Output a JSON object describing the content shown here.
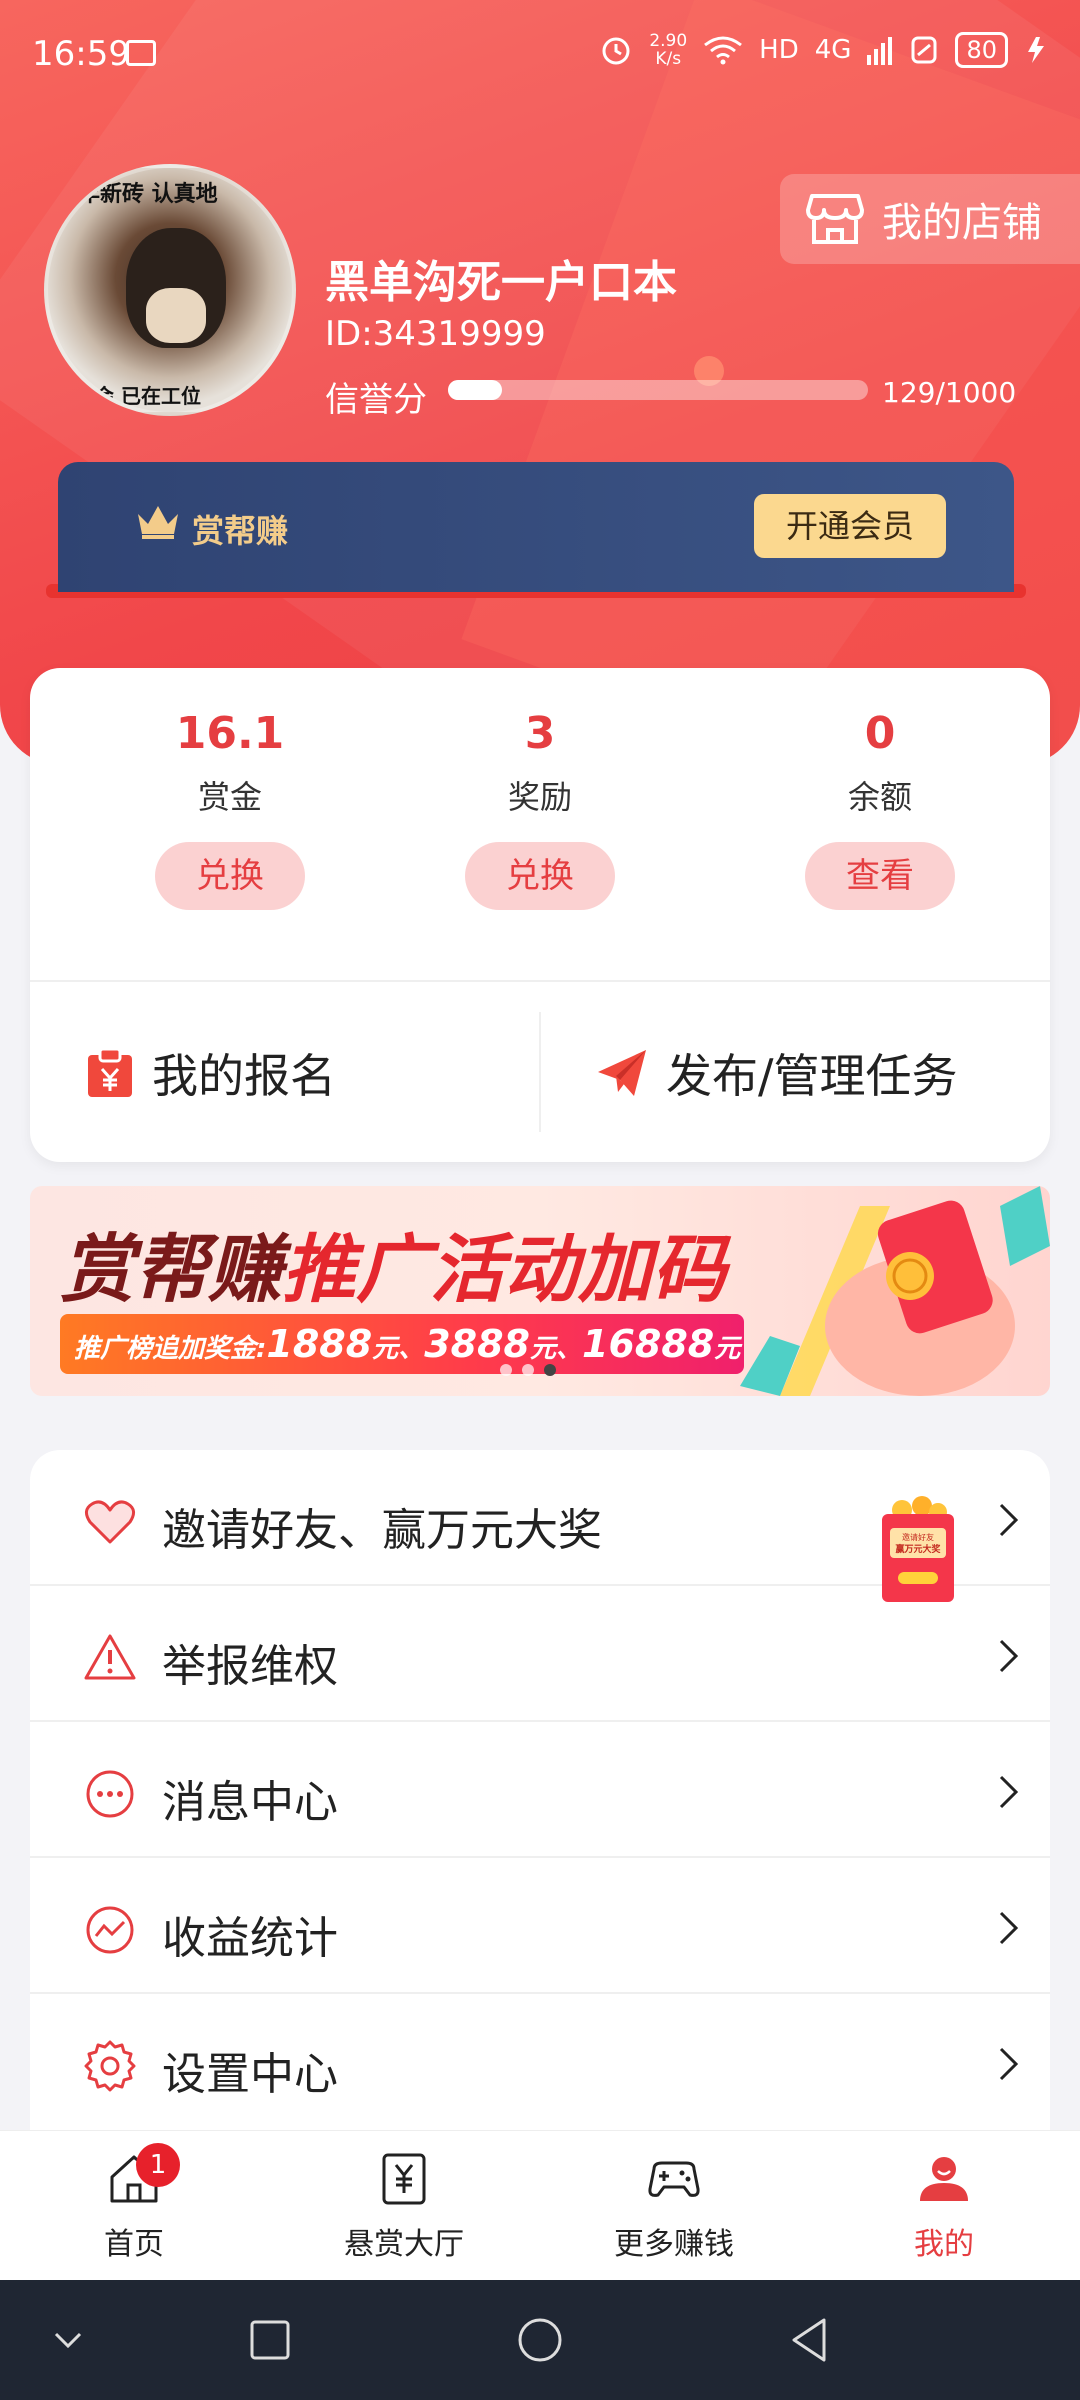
{
  "status_bar": {
    "time": "16:59",
    "net_speed_value": "2.90",
    "net_speed_unit": "K/s",
    "hd": "HD",
    "network": "4G",
    "battery": "80"
  },
  "profile": {
    "avatar_caption_top": "年新砖 认真地",
    "avatar_caption_bottom": "我会 已在工位",
    "username": "黑单沟死一户口本",
    "id": "ID:34319999",
    "credit_label": "信誉分",
    "credit_value": "129/1000",
    "credit_fraction": 0.129
  },
  "shop_button": {
    "label": "我的店铺",
    "icon": "store-icon"
  },
  "vip": {
    "label": "赏帮赚",
    "icon": "crown-icon",
    "button": "开通会员"
  },
  "balances": [
    {
      "value": "16.1",
      "label": "赏金",
      "button": "兑换"
    },
    {
      "value": "3",
      "label": "奖励",
      "button": "兑换"
    },
    {
      "value": "0",
      "label": "余额",
      "button": "查看"
    }
  ],
  "actions": {
    "signup": {
      "label": "我的报名",
      "icon": "clipboard-yen-icon"
    },
    "publish": {
      "label": "发布/管理任务",
      "icon": "paper-plane-icon"
    }
  },
  "banner": {
    "title_dark": "赏帮赚",
    "title_highlight": "推广活动加码",
    "strip_prefix": "推广榜追加奖金:",
    "strip_amount1": "1888",
    "strip_amount2": "3888",
    "strip_amount3": "16888",
    "unit": "元",
    "separator": "、",
    "art_caption_top": "邀请好友",
    "art_caption_main": "赢万元大奖"
  },
  "menu": [
    {
      "label": "邀请好友、赢万元大奖",
      "icon": "heart-icon"
    },
    {
      "label": "举报维权",
      "icon": "warning-icon"
    },
    {
      "label": "消息中心",
      "icon": "message-dots-icon"
    },
    {
      "label": "收益统计",
      "icon": "trend-chart-icon"
    },
    {
      "label": "设置中心",
      "icon": "gear-icon"
    }
  ],
  "tabs": [
    {
      "label": "首页",
      "icon": "home-icon",
      "badge": "1"
    },
    {
      "label": "悬赏大厅",
      "icon": "yen-board-icon"
    },
    {
      "label": "更多赚钱",
      "icon": "gamepad-icon"
    },
    {
      "label": "我的",
      "icon": "person-icon",
      "active": true
    }
  ],
  "colors": {
    "brand_red": "#e53e41",
    "header_red": "#f1474a",
    "vip_navy": "#2f4372",
    "vip_gold": "#fbd88f"
  }
}
